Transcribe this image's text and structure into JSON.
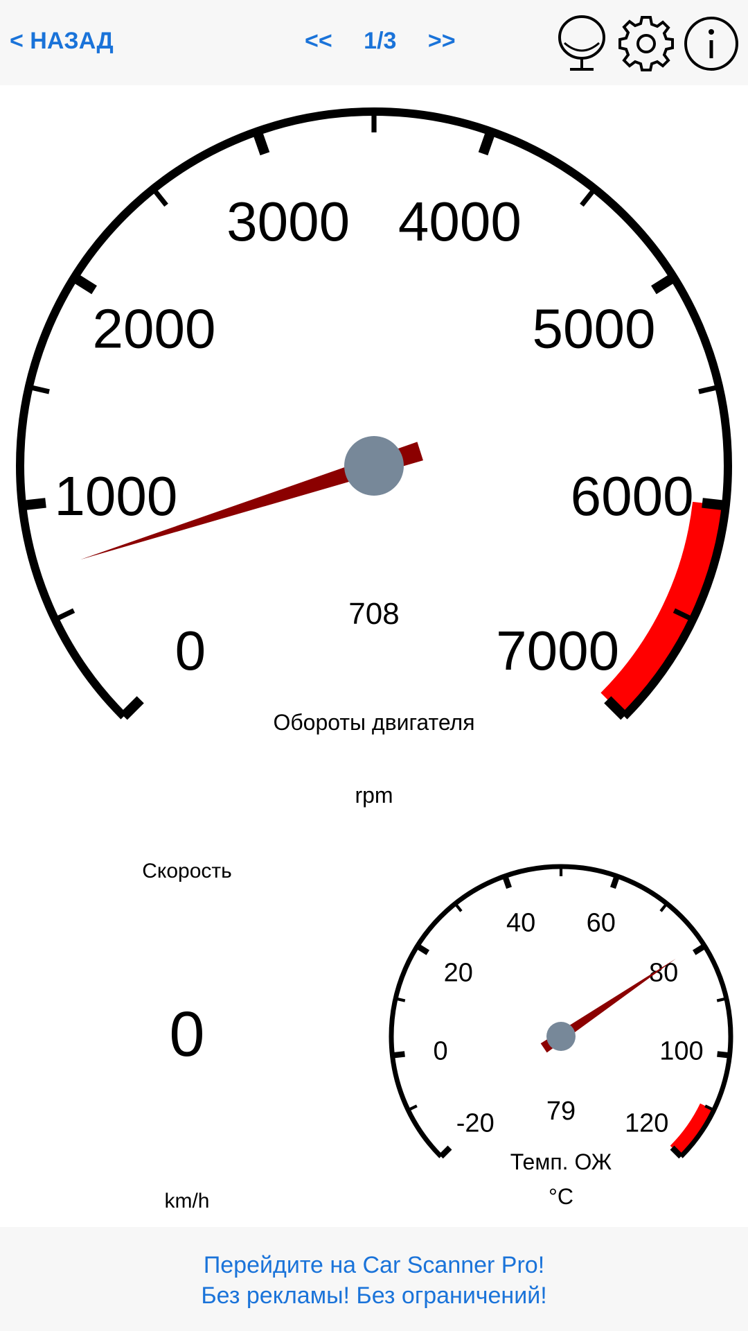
{
  "header": {
    "back_label": "< НАЗАД",
    "prev_label": "<<",
    "page_indicator": "1/3",
    "next_label": ">>",
    "icons": [
      "mirror-icon",
      "gear-icon",
      "info-icon"
    ]
  },
  "rpm_gauge": {
    "title": "Обороты двигателя",
    "unit": "rpm",
    "value": 708,
    "value_label": "708",
    "min": 0,
    "max": 7000,
    "red_from": 6000,
    "tick_labels": [
      "0",
      "1000",
      "2000",
      "3000",
      "4000",
      "5000",
      "6000",
      "7000"
    ]
  },
  "speed": {
    "title": "Скорость",
    "value": "0",
    "unit": "km/h"
  },
  "coolant_gauge": {
    "title": "Темп. ОЖ",
    "unit": "°C",
    "value": 79,
    "value_label": "79",
    "min": -20,
    "max": 120,
    "red_from": 110,
    "tick_labels": [
      "-20",
      "0",
      "20",
      "40",
      "60",
      "80",
      "100",
      "120"
    ]
  },
  "promo": {
    "line1": "Перейдите на Car Scanner Pro!",
    "line2": "Без рекламы! Без ограничений!"
  },
  "colors": {
    "accent": "#1a73d9",
    "needle": "#8b0000",
    "hub": "#778899",
    "red_zone": "#ff0000"
  }
}
